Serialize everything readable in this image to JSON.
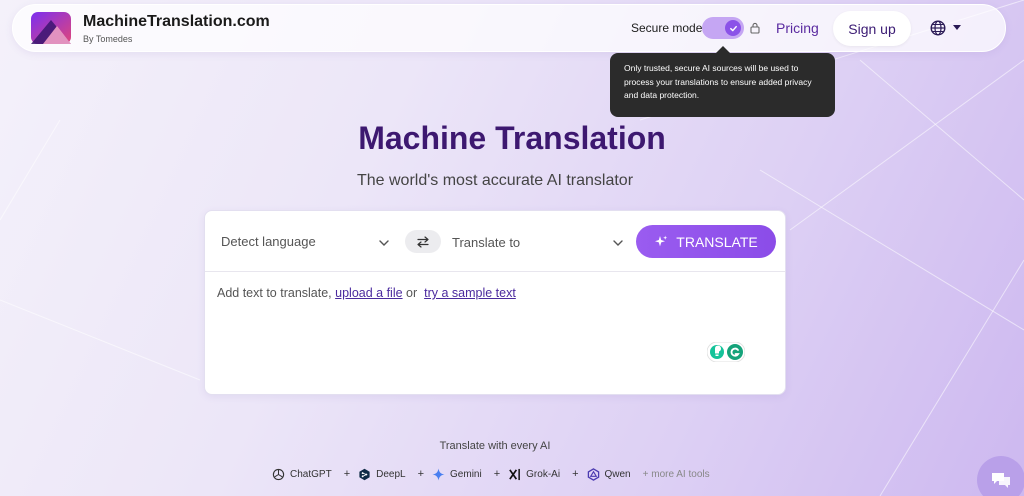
{
  "brand": {
    "name": "MachineTranslation.com",
    "sub": "By Tomedes"
  },
  "nav": {
    "secure_mode_label": "Secure mode",
    "secure_mode_on": true,
    "pricing": "Pricing",
    "signup": "Sign up",
    "language_icon": "globe-icon"
  },
  "tooltip": {
    "text": "Only trusted, secure AI sources will be used to process your translations to ensure added privacy and data protection."
  },
  "hero": {
    "title": "Machine Translation",
    "subtitle": "The world's most accurate AI translator"
  },
  "translator": {
    "source_language": "Detect language",
    "target_language": "Translate to",
    "translate_button": "TRANSLATE",
    "input_prefix": "Add text to translate,",
    "upload_link": "upload a file",
    "or_text": "or",
    "sample_link": "try a sample text"
  },
  "ai_tools": {
    "title": "Translate with every AI",
    "items": [
      {
        "name": "ChatGPT",
        "icon": "chatgpt-icon"
      },
      {
        "name": "DeepL",
        "icon": "deepl-icon"
      },
      {
        "name": "Gemini",
        "icon": "gemini-icon"
      },
      {
        "name": "Grok-Ai",
        "icon": "grok-icon"
      },
      {
        "name": "Qwen",
        "icon": "qwen-icon"
      }
    ],
    "more": "+ more AI tools"
  },
  "colors": {
    "accent": "#8b4ce8",
    "title": "#3d1870",
    "tooltip_bg": "#2b2b2b"
  }
}
